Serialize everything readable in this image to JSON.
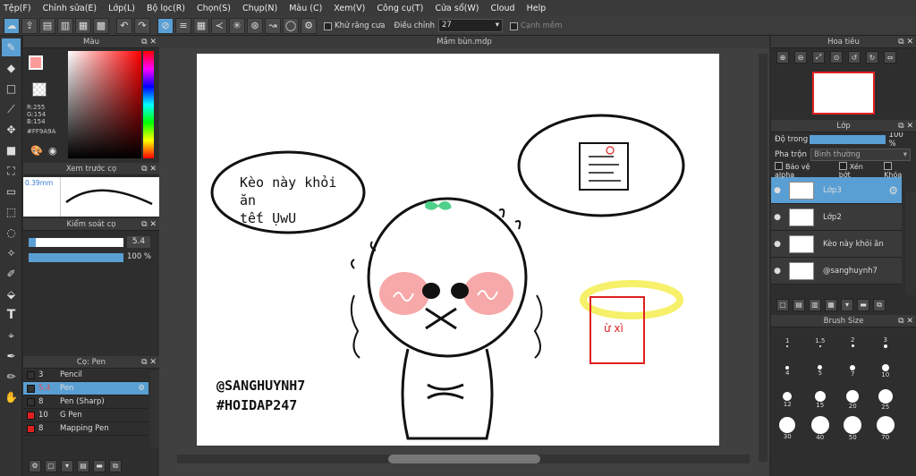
{
  "menu": [
    "Tệp(F)",
    "Chỉnh sửa(E)",
    "Lớp(L)",
    "Bộ lọc(R)",
    "Chọn(S)",
    "Chụp(N)",
    "Màu (C)",
    "Xem(V)",
    "Công cụ(T)",
    "Cửa sổ(W)",
    "Cloud",
    "Help"
  ],
  "toolbar": {
    "antialias_label": "Khử răng cưa",
    "adjust_label": "Điều chỉnh",
    "adjust_value": "27",
    "smooth_label": "Cạnh mềm"
  },
  "color_panel": {
    "title": "Màu",
    "r": "R:255",
    "g": "G:154",
    "b": "B:154",
    "hex": "#FF9A9A",
    "fg_color": "#ff9a9a"
  },
  "brush_preview": {
    "title": "Xem trước cọ",
    "size": "0.39mm"
  },
  "brush_control": {
    "title": "Kiểm soát cọ",
    "size_value": "5.4",
    "opacity_value": "100 %"
  },
  "brush_list": {
    "title": "Cọ: Pen",
    "items": [
      {
        "size": "3",
        "name": "Pencil",
        "color": "#333333"
      },
      {
        "size": "5.4",
        "name": "Pen",
        "color": "#333333",
        "selected": true
      },
      {
        "size": "8",
        "name": "Pen (Sharp)",
        "color": "#333333"
      },
      {
        "size": "10",
        "name": "G Pen",
        "color": "#e02020"
      },
      {
        "size": "8",
        "name": "Mapping Pen",
        "color": "#e02020"
      }
    ]
  },
  "document": {
    "tab": "Mắm bùn.mdp",
    "bubble1_line1": "Kèo này khỏi ăn",
    "bubble1_line2": "tết ỤwU",
    "watermark1": "@SANGHUYNH7",
    "watermark2": "#HOIDAP247",
    "note_text": "ừ xì"
  },
  "navigator": {
    "title": "Hoa tiêu"
  },
  "layers": {
    "title": "Lớp",
    "opacity_label": "Độ trong",
    "opacity_value": "100 %",
    "blend_label": "Pha trộn",
    "blend_value": "Bình thường",
    "protect_alpha": "Bảo vệ alpha",
    "clipping": "Xén bớt",
    "lock": "Khóa",
    "items": [
      {
        "name": "Lớp3",
        "selected": true
      },
      {
        "name": "Lớp2"
      },
      {
        "name": "Kèo này khỏi ăn"
      },
      {
        "name": "@sanghuynh7"
      }
    ]
  },
  "brush_size": {
    "title": "Brush Size",
    "sizes": [
      "1",
      "1.5",
      "2",
      "3",
      "4",
      "5",
      "7",
      "10",
      "12",
      "15",
      "20",
      "25",
      "30",
      "40",
      "50",
      "70"
    ]
  }
}
